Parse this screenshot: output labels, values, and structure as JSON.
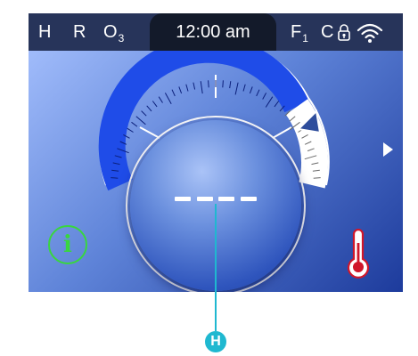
{
  "status_bar": {
    "h_label": "H",
    "r_label": "R",
    "ozone_label": "O",
    "ozone_sub": "3",
    "time": "12:00 am",
    "filter_label": "F",
    "filter_sub": "1",
    "c_label": "C",
    "lock_icon": "padlock-icon",
    "wifi_icon": "wifi-icon",
    "bar_color": "#27345a",
    "clock_tab_color": "#131a2a"
  },
  "dial": {
    "display_value": "----",
    "active_arc_color": "#1f4ce8",
    "inactive_arc_color": "#ffffff",
    "pointer_color": "#2e4d9c",
    "set_level_fraction": 0.78
  },
  "controls": {
    "info_button_glyph": "i",
    "info_button_color": "#39d63f",
    "next_icon": "play-arrow-icon",
    "thermometer_icon": "thermometer-icon",
    "thermometer_color": "#d0162a"
  },
  "callout": {
    "label": "H",
    "color": "#1fb8d0"
  }
}
